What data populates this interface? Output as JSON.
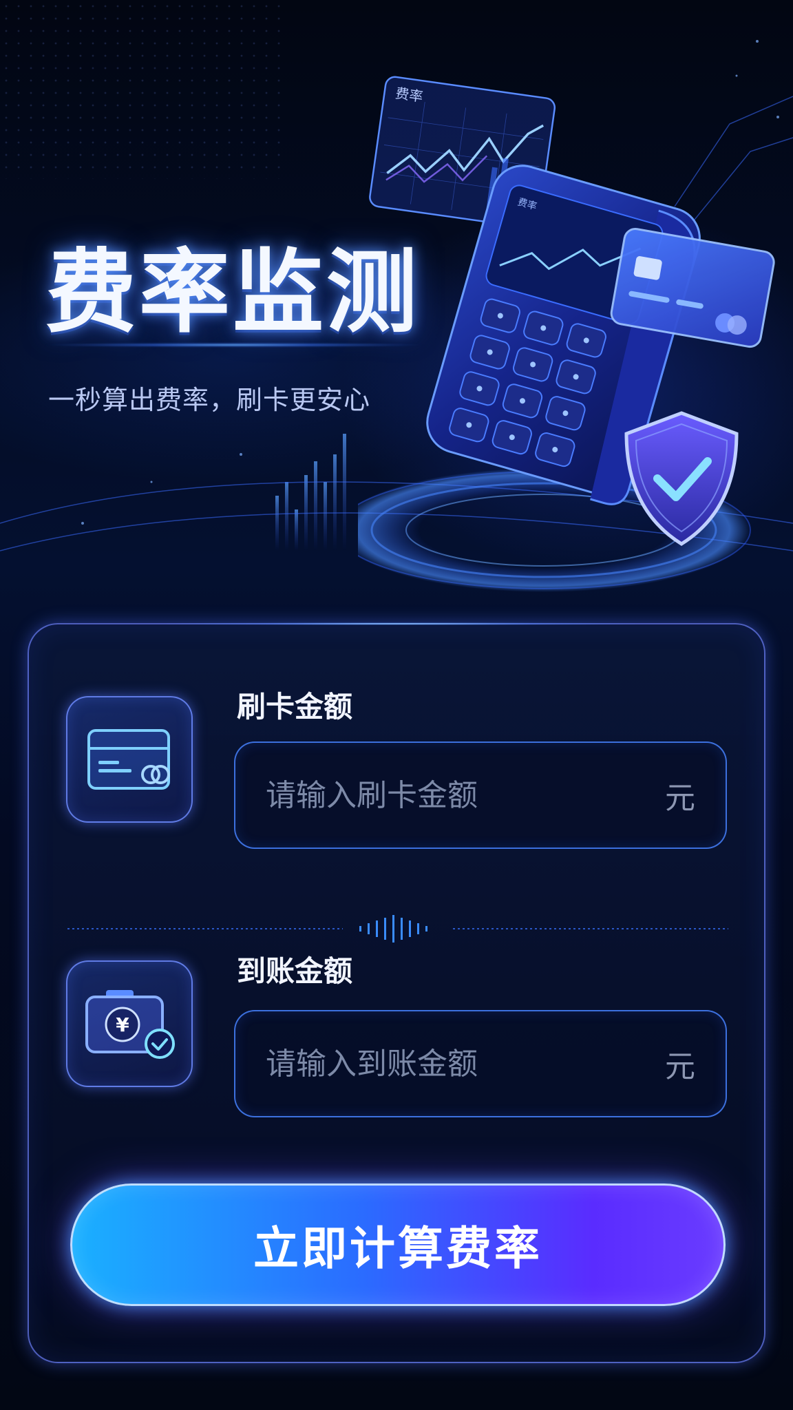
{
  "hero": {
    "title": "费率监测",
    "subtitle": "一秒算出费率，刷卡更安心",
    "chart_panel_label": "费率",
    "pos_screen_label": "费率"
  },
  "form": {
    "swipe": {
      "label": "刷卡金额",
      "placeholder": "请输入刷卡金额",
      "unit": "元",
      "icon": "credit-card-icon"
    },
    "received": {
      "label": "到账金额",
      "placeholder": "请输入到账金额",
      "unit": "元",
      "icon": "wallet-yuan-check-icon"
    },
    "submit_label": "立即计算费率"
  },
  "colors": {
    "background": "#030816",
    "accent_blue": "#2b6bff",
    "accent_cyan": "#1ab0ff",
    "accent_purple": "#6a3cff",
    "border": "#6e82ff"
  }
}
